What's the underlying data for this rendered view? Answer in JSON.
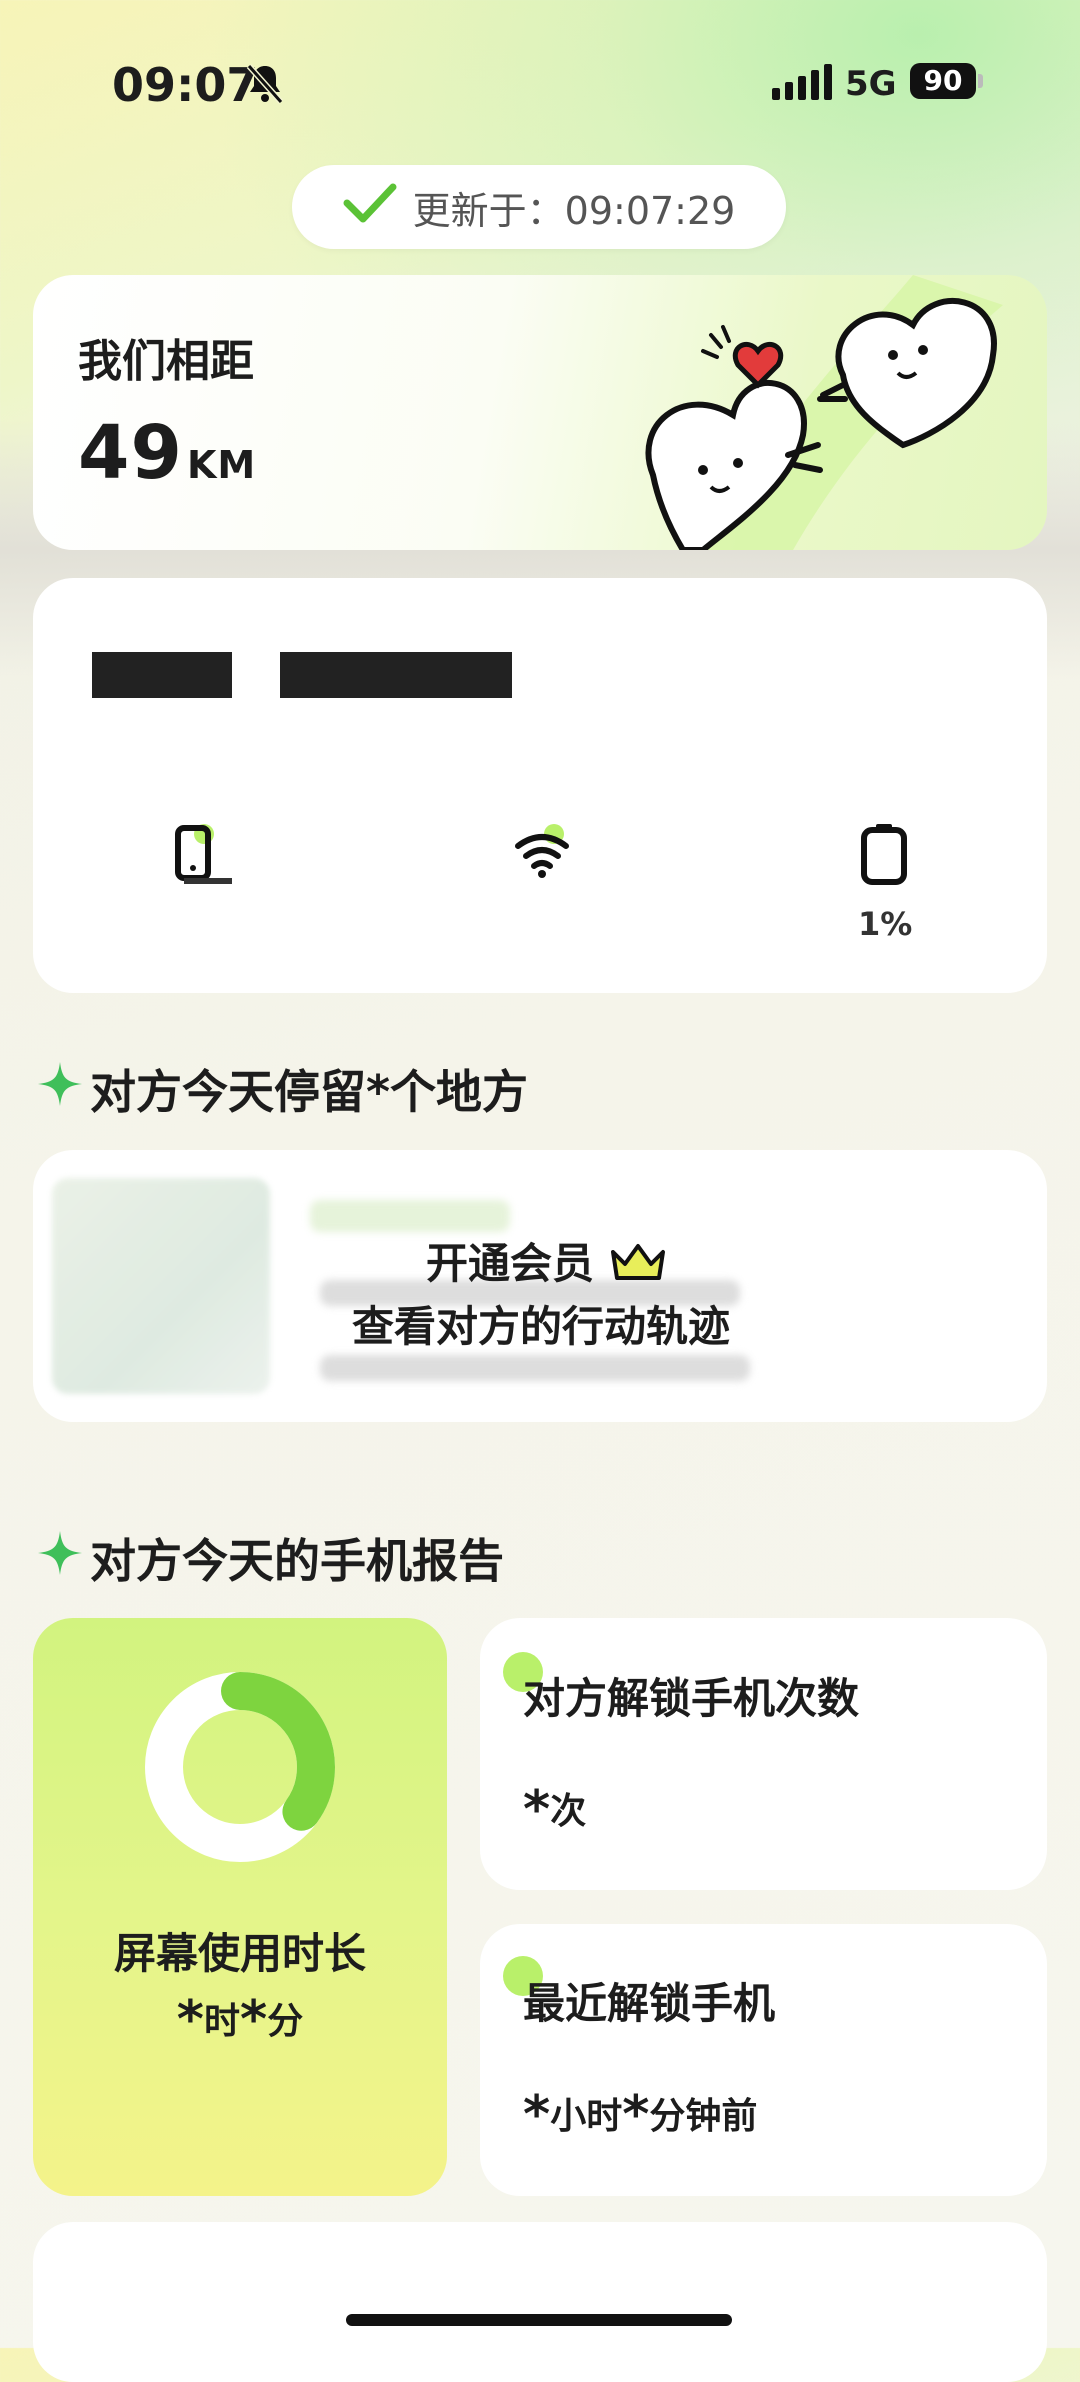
{
  "status_bar": {
    "time": "09:07",
    "network": "5G",
    "battery": "90"
  },
  "update": {
    "prefix": "更新于：",
    "time": "09:07:29"
  },
  "distance": {
    "label": "我们相距",
    "value": "49",
    "unit": "KM"
  },
  "device": {
    "battery_percent": "1%"
  },
  "places": {
    "title": "对方今天停留*个地方"
  },
  "trace": {
    "line1": "开通会员",
    "line2": "查看对方的行动轨迹"
  },
  "report": {
    "title": "对方今天的手机报告",
    "screen_time": {
      "label": "屏幕使用时长",
      "hours_unit": "时",
      "minutes_unit": "分",
      "placeholder": "*"
    },
    "unlock_count": {
      "label": "对方解锁手机次数",
      "unit": "次",
      "placeholder": "*"
    },
    "last_unlock": {
      "label": "最近解锁手机",
      "hours_unit": "小时",
      "minutes_unit": "分钟前",
      "placeholder": "*"
    },
    "ring_progress": 0.35
  },
  "colors": {
    "accent_green": "#7ed43f",
    "check_green": "#5bc236",
    "heart_red": "#e23b3b"
  }
}
